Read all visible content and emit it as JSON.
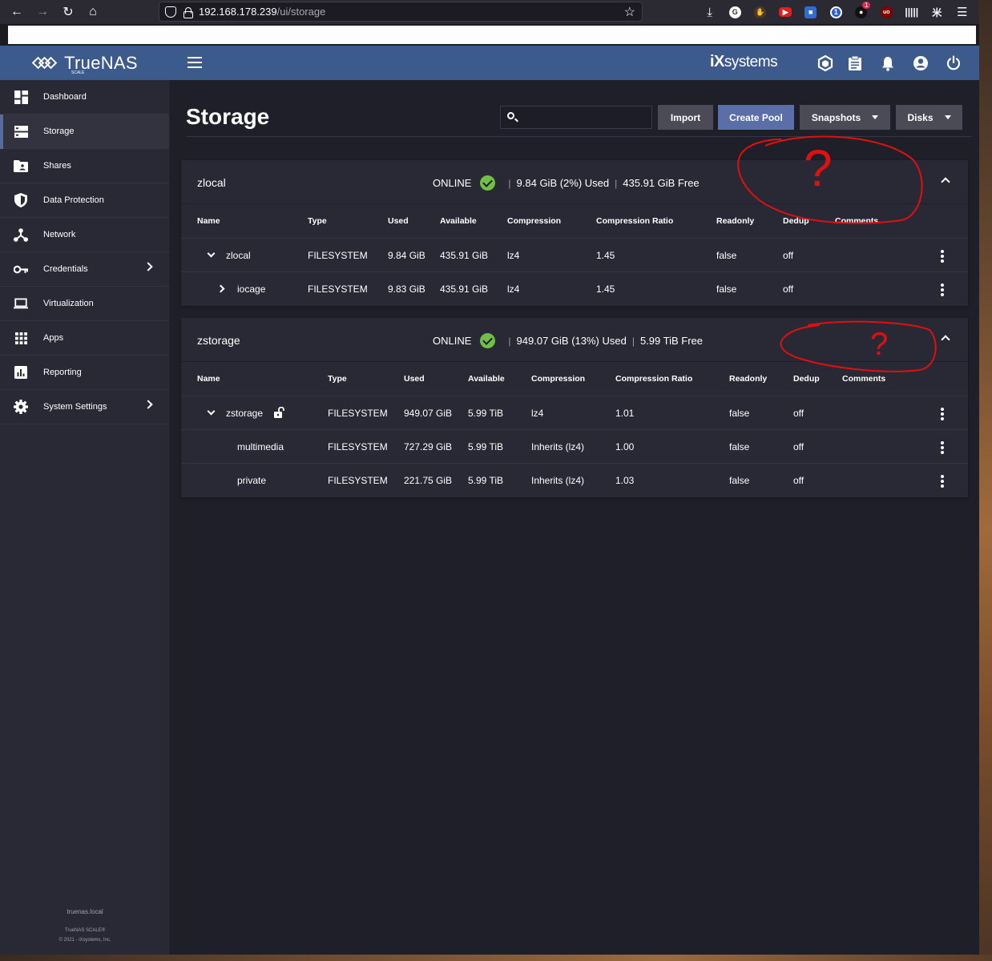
{
  "browser": {
    "url_host": "192.168.178.239",
    "url_path": "/ui/storage",
    "extension_badge": "1"
  },
  "app": {
    "logo_text": "TrueNAS",
    "logo_sub": "SCALE",
    "vendor_logo_ix": "iX",
    "vendor_logo_systems": "systems"
  },
  "sidebar": {
    "items": [
      {
        "label": "Dashboard",
        "icon": "dashboard-icon"
      },
      {
        "label": "Storage",
        "icon": "storage-icon",
        "active": true
      },
      {
        "label": "Shares",
        "icon": "shares-icon"
      },
      {
        "label": "Data Protection",
        "icon": "shield-icon"
      },
      {
        "label": "Network",
        "icon": "network-icon"
      },
      {
        "label": "Credentials",
        "icon": "key-icon",
        "has_submenu": true
      },
      {
        "label": "Virtualization",
        "icon": "laptop-icon"
      },
      {
        "label": "Apps",
        "icon": "apps-grid-icon"
      },
      {
        "label": "Reporting",
        "icon": "chart-icon"
      },
      {
        "label": "System Settings",
        "icon": "gear-icon",
        "has_submenu": true
      }
    ],
    "footer_host": "truenas.local",
    "footer_product": "TrueNAS SCALE®",
    "footer_copyright": "© 2021 - iXsystems, Inc."
  },
  "page": {
    "title": "Storage",
    "search_placeholder": "",
    "buttons": {
      "import": "Import",
      "create_pool": "Create Pool",
      "snapshots": "Snapshots",
      "disks": "Disks"
    }
  },
  "pools": [
    {
      "name": "zlocal",
      "status": "ONLINE",
      "used": "9.84 GiB (2%) Used",
      "free": "435.91 GiB Free",
      "columns": [
        "Name",
        "Type",
        "Used",
        "Available",
        "Compression",
        "Compression Ratio",
        "Readonly",
        "Dedup",
        "Comments"
      ],
      "rows": [
        {
          "name": "zlocal",
          "type": "FILESYSTEM",
          "used": "9.84 GiB",
          "available": "435.91 GiB",
          "compression": "lz4",
          "ratio": "1.45",
          "readonly": "false",
          "dedup": "off"
        },
        {
          "name": "iocage",
          "type": "FILESYSTEM",
          "used": "9.83 GiB",
          "available": "435.91 GiB",
          "compression": "lz4",
          "ratio": "1.45",
          "readonly": "false",
          "dedup": "off"
        }
      ]
    },
    {
      "name": "zstorage",
      "status": "ONLINE",
      "used": "949.07 GiB (13%) Used",
      "free": "5.99 TiB Free",
      "columns": [
        "Name",
        "Type",
        "Used",
        "Available",
        "Compression",
        "Compression Ratio",
        "Readonly",
        "Dedup",
        "Comments"
      ],
      "rows": [
        {
          "name": "zstorage",
          "type": "FILESYSTEM",
          "used": "949.07 GiB",
          "available": "5.99 TiB",
          "compression": "lz4",
          "ratio": "1.01",
          "readonly": "false",
          "dedup": "off"
        },
        {
          "name": "multimedia",
          "type": "FILESYSTEM",
          "used": "727.29 GiB",
          "available": "5.99 TiB",
          "compression": "Inherits (lz4)",
          "ratio": "1.00",
          "readonly": "false",
          "dedup": "off"
        },
        {
          "name": "private",
          "type": "FILESYSTEM",
          "used": "221.75 GiB",
          "available": "5.99 TiB",
          "compression": "Inherits (lz4)",
          "ratio": "1.03",
          "readonly": "false",
          "dedup": "off"
        }
      ]
    }
  ],
  "annotations": {
    "mark": "?",
    "color": "#e01010"
  },
  "colors": {
    "topbar": "#3d5a8c",
    "primary_button": "#5b6ea7",
    "online_check": "#71bf44"
  }
}
